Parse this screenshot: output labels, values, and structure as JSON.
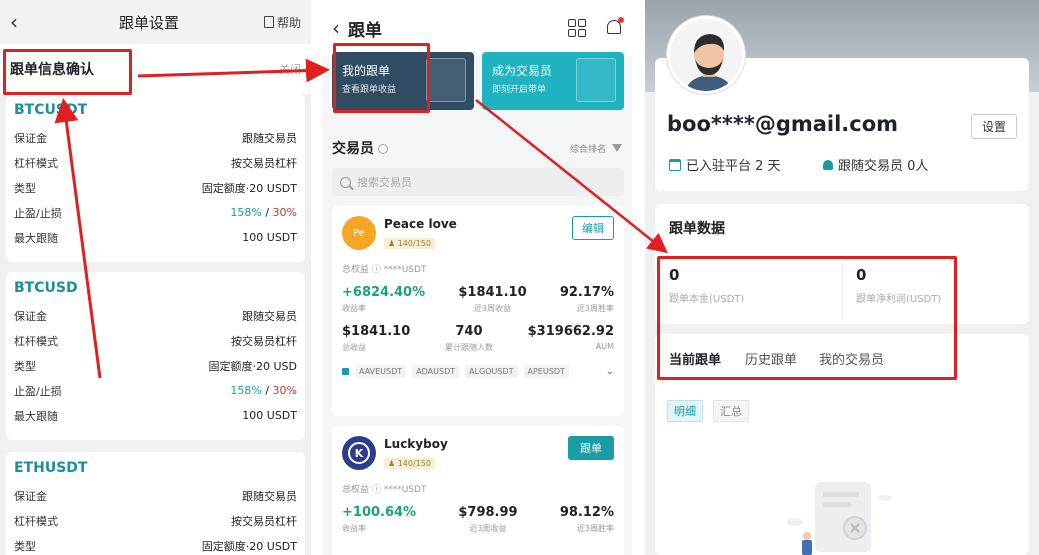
{
  "panel1": {
    "back_glyph": "‹",
    "title": "跟单设置",
    "help": "帮助",
    "confirm_title": "跟单信息确认",
    "close": "关闭",
    "cards": [
      {
        "pair": "BTCUSDT",
        "rows": [
          {
            "label": "保证金",
            "value": "跟随交易员"
          },
          {
            "label": "杠杆模式",
            "value": "按交易员杠杆"
          },
          {
            "label": "类型",
            "value": "固定额度·20 USDT"
          },
          {
            "label": "止盈/止损",
            "tp": "158%",
            "sl": "30%"
          },
          {
            "label": "最大跟随",
            "value": "100 USDT"
          }
        ]
      },
      {
        "pair": "BTCUSD",
        "rows": [
          {
            "label": "保证金",
            "value": "跟随交易员"
          },
          {
            "label": "杠杆模式",
            "value": "按交易员杠杆"
          },
          {
            "label": "类型",
            "value": "固定额度·20 USD"
          },
          {
            "label": "止盈/止损",
            "tp": "158%",
            "sl": "30%"
          },
          {
            "label": "最大跟随",
            "value": "100 USDT"
          }
        ]
      },
      {
        "pair": "ETHUSDT",
        "rows": [
          {
            "label": "保证金",
            "value": "跟随交易员"
          },
          {
            "label": "杠杆模式",
            "value": "按交易员杠杆"
          },
          {
            "label": "类型",
            "value": "固定额度·20 USDT"
          }
        ]
      }
    ],
    "sep": "/"
  },
  "panel2": {
    "back_glyph": "‹",
    "title": "跟单",
    "banner_my": {
      "title": "我的跟单",
      "sub": "查看跟单收益"
    },
    "banner_become": {
      "title": "成为交易员",
      "sub": "即刻开启带单"
    },
    "traders_title": "交易员",
    "sort_label": "综合排名",
    "search_placeholder": "搜索交易员",
    "trader1": {
      "initials": "Pe",
      "name": "Peace love",
      "count": "140/150",
      "button": "编辑",
      "equity": "总权益 ⓘ ****USDT",
      "stats1": [
        {
          "n": "+6824.40%",
          "l": "收益率"
        },
        {
          "n": "$1841.10",
          "l": "近3周收益"
        },
        {
          "n": "92.17%",
          "l": "近3周胜率"
        }
      ],
      "stats2": [
        {
          "n": "$1841.10",
          "l": "总收益"
        },
        {
          "n": "740",
          "l": "累计跟随人数"
        },
        {
          "n": "$319662.92",
          "l": "AUM"
        }
      ],
      "tags": [
        "AAVEUSDT",
        "ADAUSDT",
        "ALGOUSDT",
        "APEUSDT"
      ],
      "chevron": "⌄"
    },
    "trader2": {
      "initials": "K",
      "name": "Luckyboy",
      "count": "140/150",
      "button": "跟单",
      "equity": "总权益 ⓘ ****USDT",
      "stats1": [
        {
          "n": "+100.64%",
          "l": "收益率"
        },
        {
          "n": "$798.99",
          "l": "近3周收益"
        },
        {
          "n": "98.12%",
          "l": "近3周胜率"
        }
      ]
    }
  },
  "panel3": {
    "email": "boo****@gmail.com",
    "settings": "设置",
    "joined": "已入驻平台 2 天",
    "following": "跟随交易员 0人",
    "data_title": "跟单数据",
    "principal_value": "0",
    "principal_label": "跟单本金(USDT)",
    "profit_value": "0",
    "profit_label": "跟单净利润(USDT)",
    "tabs": [
      "当前跟单",
      "历史跟单",
      "我的交易员"
    ],
    "subtabs": [
      "明细",
      "汇总"
    ]
  },
  "colors": {
    "accent": "#1a9ba8",
    "highlight": "#e02020",
    "profit": "#1aa37a",
    "loss": "#c0392b"
  }
}
